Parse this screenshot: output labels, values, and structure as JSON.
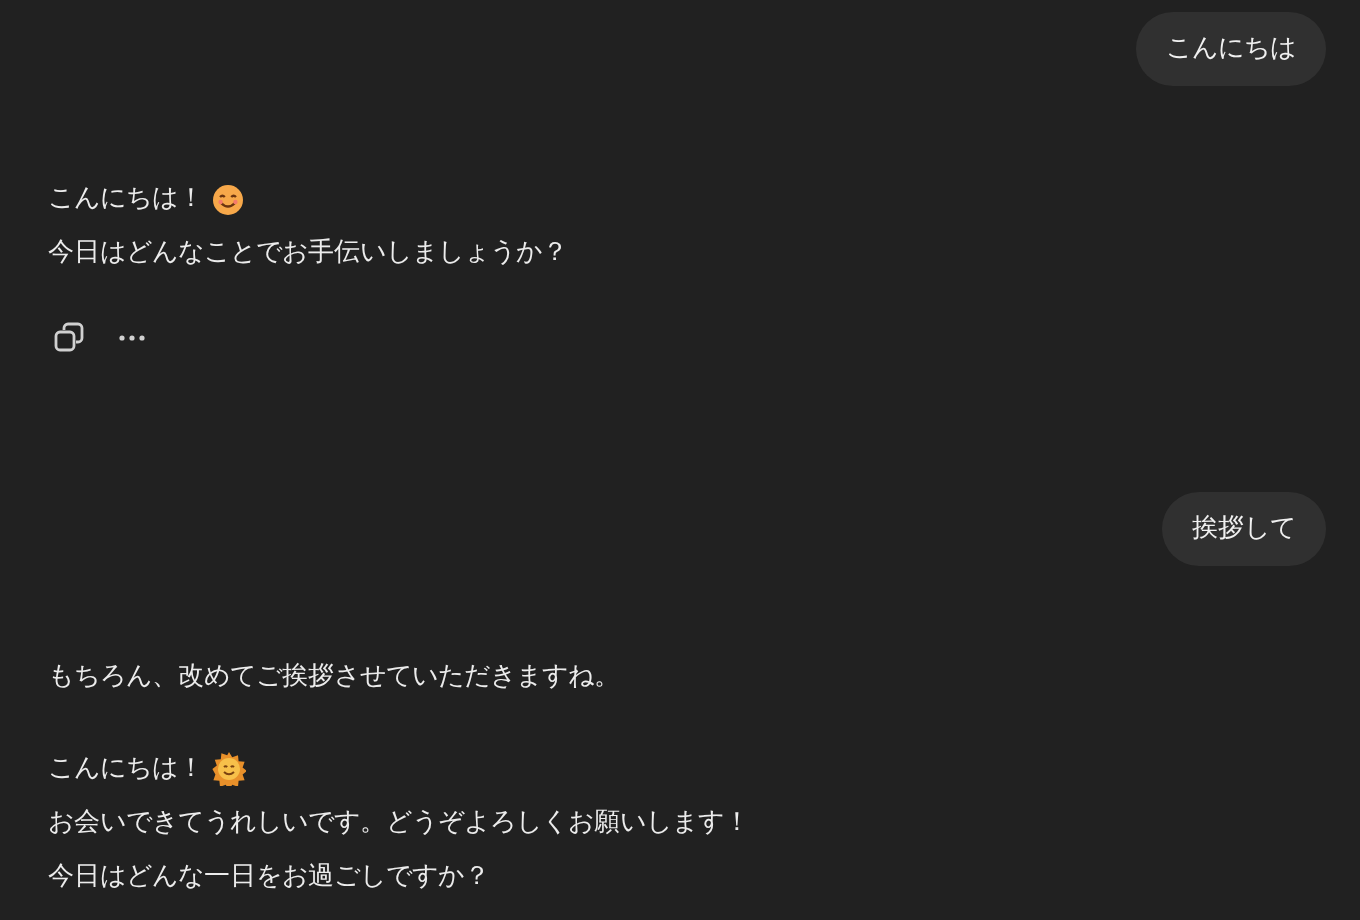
{
  "messages": [
    {
      "kind": "user",
      "text": "こんにちは"
    },
    {
      "kind": "assistant",
      "show_actions": true,
      "paragraphs": [
        [
          {
            "text": "こんにちは！",
            "kind": "smile"
          },
          {
            "text": "今日はどんなことでお手伝いしましょうか？",
            "kind": "plain"
          }
        ]
      ]
    },
    {
      "kind": "user",
      "text": "挨拶して"
    },
    {
      "kind": "assistant",
      "paragraphs": [
        [
          {
            "text": "もちろん、改めてご挨拶させていただきますね。",
            "kind": "plain"
          }
        ],
        [
          {
            "text": "こんにちは！",
            "kind": "sun"
          },
          {
            "text": "お会いできてうれしいです。どうぞよろしくお願いします！",
            "kind": "plain"
          },
          {
            "text": "今日はどんな一日をお過ごしですか？",
            "kind": "plain"
          }
        ]
      ]
    }
  ]
}
